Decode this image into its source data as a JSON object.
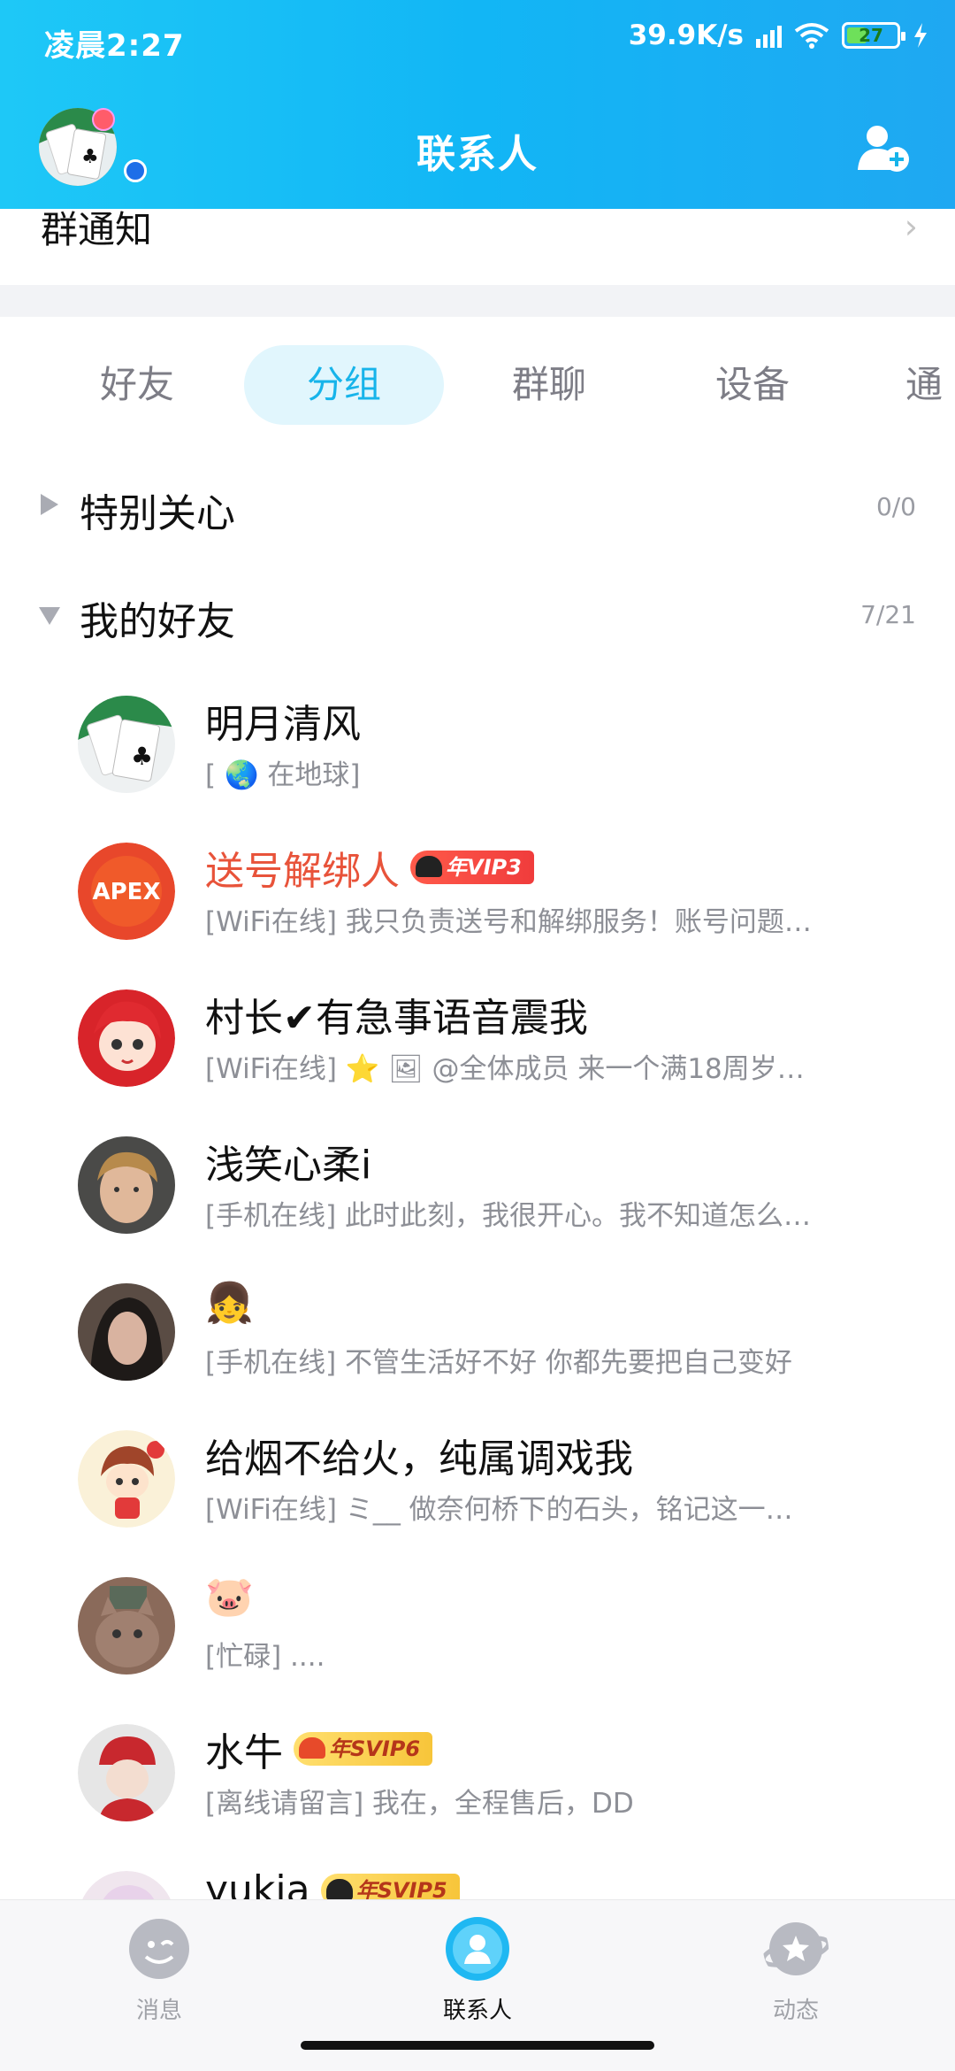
{
  "status_bar": {
    "time": "凌晨2:27",
    "net_speed": "39.9K/s",
    "battery": "27"
  },
  "header": {
    "title": "联系人"
  },
  "notice": {
    "label": "群通知"
  },
  "tabs": [
    {
      "label": "好友",
      "active": false
    },
    {
      "label": "分组",
      "active": true
    },
    {
      "label": "群聊",
      "active": false
    },
    {
      "label": "设备",
      "active": false
    },
    {
      "label": "通",
      "active": false
    }
  ],
  "groups": [
    {
      "name": "特别关心",
      "count": "0/0",
      "expanded": false
    },
    {
      "name": "我的好友",
      "count": "7/21",
      "expanded": true
    }
  ],
  "contacts": [
    {
      "name": "明月清风",
      "status": "[ 🌏 在地球]"
    },
    {
      "name": "送号解绑人",
      "badge": "年VIP3",
      "status": "[WiFi在线] 我只负责送号和解绑服务！账号问题…"
    },
    {
      "name": "村长✔有急事语音震我",
      "status": "[WiFi在线] ⭐ 🖼 @全体成员 来一个满18周岁…"
    },
    {
      "name": "浅笑心柔i",
      "status": "[手机在线] 此时此刻，我很开心。我不知道怎么…"
    },
    {
      "name": "👧",
      "status": "[手机在线] 不管生活好不好 你都先要把自己变好"
    },
    {
      "name": "给烟不给火，纯属调戏我",
      "status": "[WiFi在线] ミ__ 做奈何桥下的石头，铭记这一…"
    },
    {
      "name": "🐷",
      "status": "[忙碌] ...."
    },
    {
      "name": "水牛",
      "badge": "年SVIP6",
      "status": "[离线请留言] 我在，全程售后，DD"
    },
    {
      "name": "yukia",
      "badge": "年SVIP5",
      "status": ""
    }
  ],
  "bottom_nav": [
    {
      "label": "消息",
      "icon": "message-icon",
      "active": false
    },
    {
      "label": "联系人",
      "icon": "contacts-icon",
      "active": true
    },
    {
      "label": "动态",
      "icon": "feed-icon",
      "active": false
    }
  ],
  "colors": {
    "header": "#12b6f5",
    "active_tab": "#17b4ea",
    "vip_name": "#e8533a"
  }
}
